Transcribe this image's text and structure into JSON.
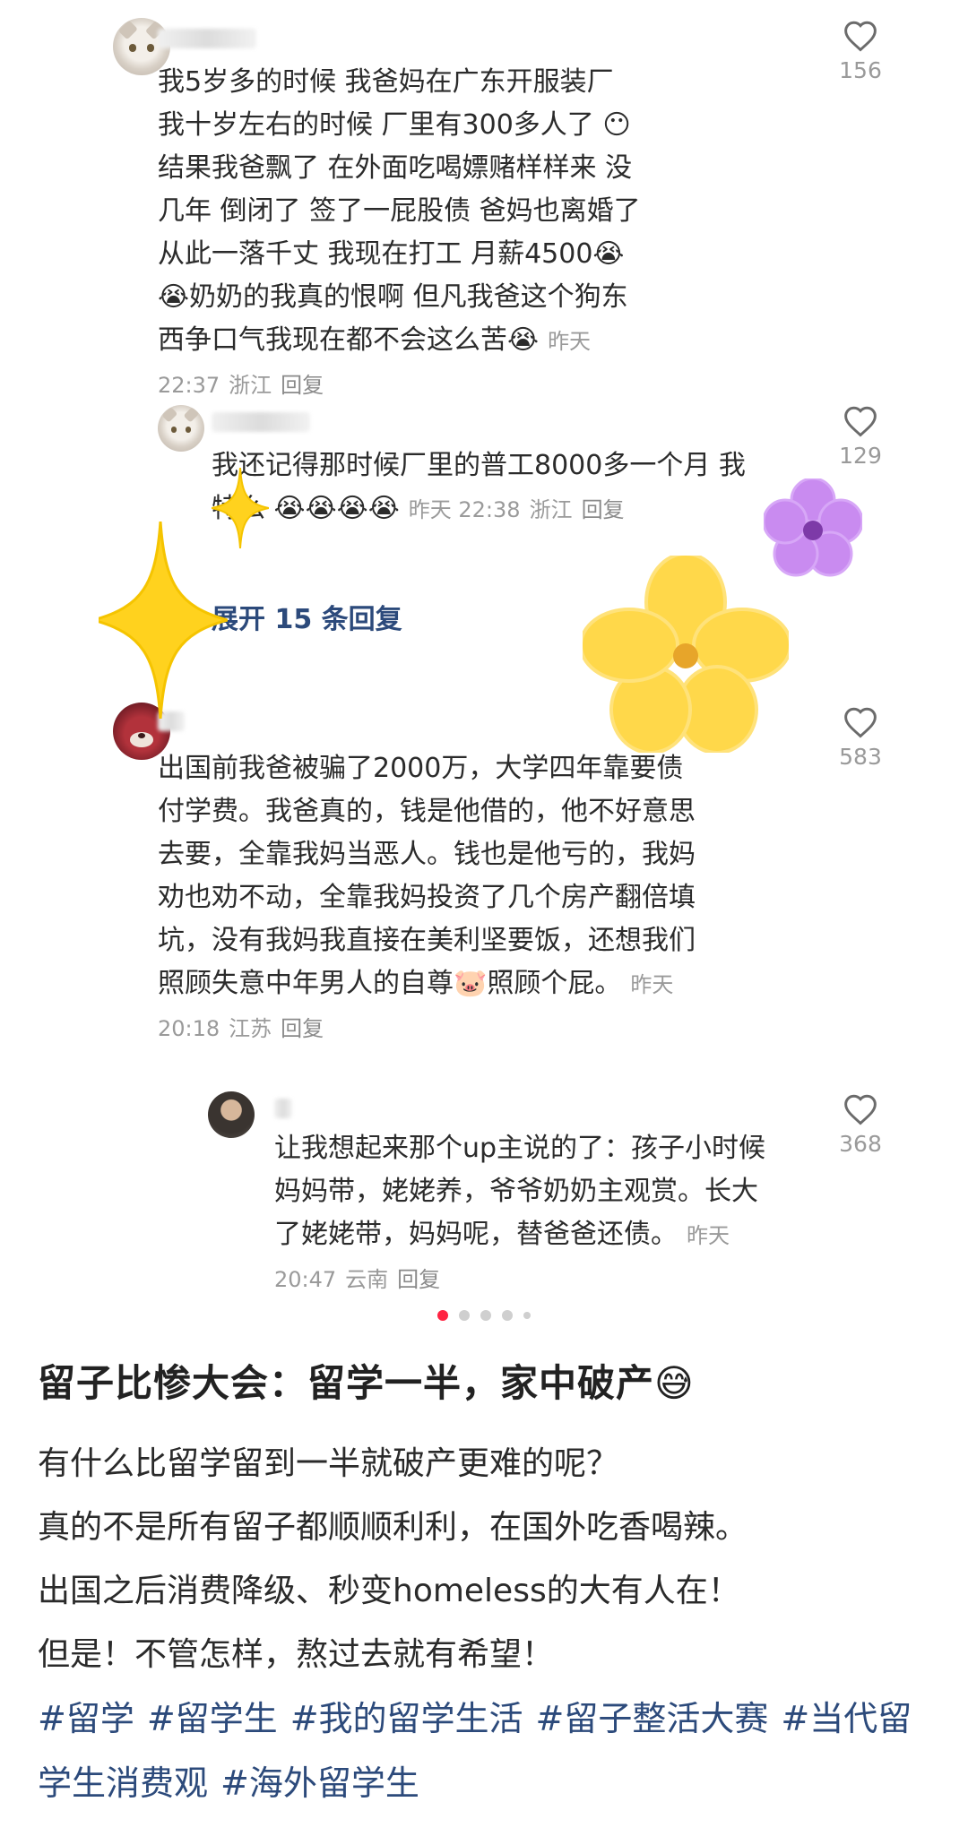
{
  "comments": [
    {
      "name": "··ng",
      "text": "我5岁多的时候 我爸妈在广东开服装厂 我十岁左右的时候 厂里有300多人了 😶 结果我爸飘了 在外面吃喝嫖赌样样来 没几年 倒闭了 签了一屁股债 爸妈也离婚了 从此一落千丈 我现在打工 月薪4500😭😭奶奶的我真的恨啊 但凡我爸这个狗东西争口气我现在都不会这么苦😭",
      "time": "昨天 22:37",
      "location": "浙江",
      "reply": "回复",
      "likes": "156"
    },
    {
      "name": "··g",
      "text": "我还记得那时候厂里的普工8000多一个月 我特么 😭😭😭😭",
      "time": "昨天 22:38",
      "location": "浙江",
      "reply": "回复",
      "likes": "129"
    },
    {
      "name": "·",
      "text": "出国前我爸被骗了2000万，大学四年靠要债付学费。我爸真的，钱是他借的，他不好意思去要，全靠我妈当恶人。钱也是他亏的，我妈劝也劝不动，全靠我妈投资了几个房产翻倍填坑，没有我妈我直接在美利坚要饭，还想我们照顾失意中年男人的自尊🐷照顾个屁。",
      "time": "昨天 20:18",
      "location": "江苏",
      "reply": "回复",
      "likes": "583"
    },
    {
      "name": "r",
      "text": "让我想起来那个up主说的了：孩子小时候妈妈带，姥姥养，爷爷奶奶主观赏。长大了姥姥带，妈妈呢，替爸爸还债。",
      "time": "昨天 20:47",
      "location": "云南",
      "reply": "回复",
      "likes": "368"
    }
  ],
  "expand_replies": "展开 15 条回复",
  "icons": {
    "like": "heart-outline-icon",
    "sticker_star": "sparkle-star-icon",
    "sticker_flower": "flower-icon"
  },
  "colors": {
    "accent": "#ff2442",
    "link": "#2c4a7b",
    "muted": "#9a9a9a",
    "star": "#ffd21e",
    "flower_yellow": "#ffd84a",
    "flower_purple": "#c98bf0"
  },
  "pagination": {
    "total": 5,
    "current": 1
  },
  "post": {
    "title": "留子比惨大会：留学一半，家中破产😅",
    "lines": [
      "有什么比留学留到一半就破产更难的呢？",
      "真的不是所有留子都顺顺利利，在国外吃香喝辣。",
      "出国之后消费降级、秒变homeless的大有人在！",
      "但是！不管怎样，熬过去就有希望！"
    ],
    "tags": [
      "#留学",
      "#留学生",
      "#我的留学生活",
      "#留子整活大赛",
      "#当代留学生消费观",
      "#海外留学生"
    ]
  }
}
